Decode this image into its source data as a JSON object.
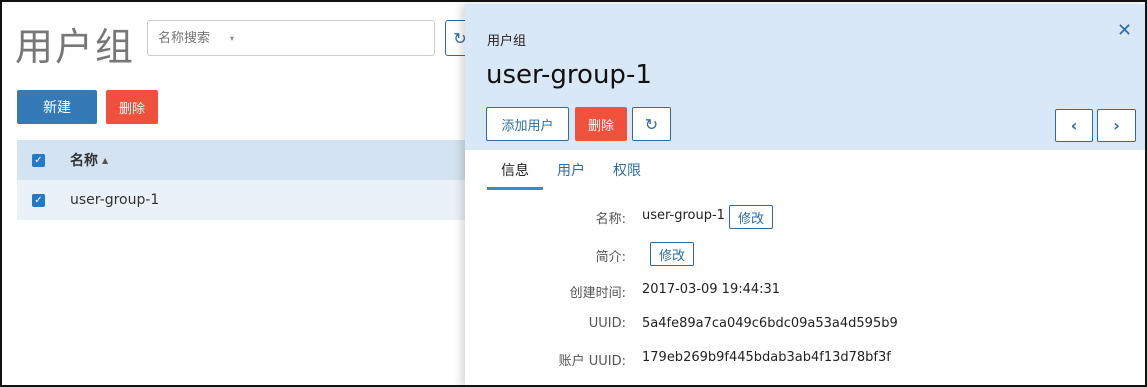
{
  "list": {
    "title": "用户组",
    "search": {
      "placeholder": "名称搜索",
      "caret": "▾"
    },
    "refresh_icon": "↻",
    "buttons": {
      "new": "新建",
      "delete": "删除"
    },
    "table": {
      "header": {
        "name": "名称",
        "sort_icon": "▲"
      },
      "rows": [
        {
          "name": "user-group-1",
          "checked": true
        }
      ]
    }
  },
  "panel": {
    "subtitle": "用户组",
    "title": "user-group-1",
    "close_icon": "✕",
    "buttons": {
      "add_user": "添加用户",
      "delete": "删除",
      "refresh_icon": "↻",
      "prev_icon": "‹",
      "next_icon": "›"
    },
    "tabs": [
      {
        "label": "信息",
        "active": true
      },
      {
        "label": "用户",
        "active": false
      },
      {
        "label": "权限",
        "active": false
      }
    ],
    "info": {
      "name_label": "名称:",
      "name_value": "user-group-1",
      "edit_label": "修改",
      "desc_label": "简介:",
      "created_label": "创建时间:",
      "created_value": "2017-03-09 19:44:31",
      "uuid_label": "UUID:",
      "uuid_value": "5a4fe89a7ca049c6bdc09a53a4d595b9",
      "account_uuid_label": "账户 UUID:",
      "account_uuid_value": "179eb269b9f445bdab3ab4f13d78bf3f"
    }
  },
  "colors": {
    "primary": "#337ab7",
    "danger": "#f0513d",
    "panel_header_bg": "#d9e8f7",
    "table_header_bg": "#d4e3f1"
  }
}
